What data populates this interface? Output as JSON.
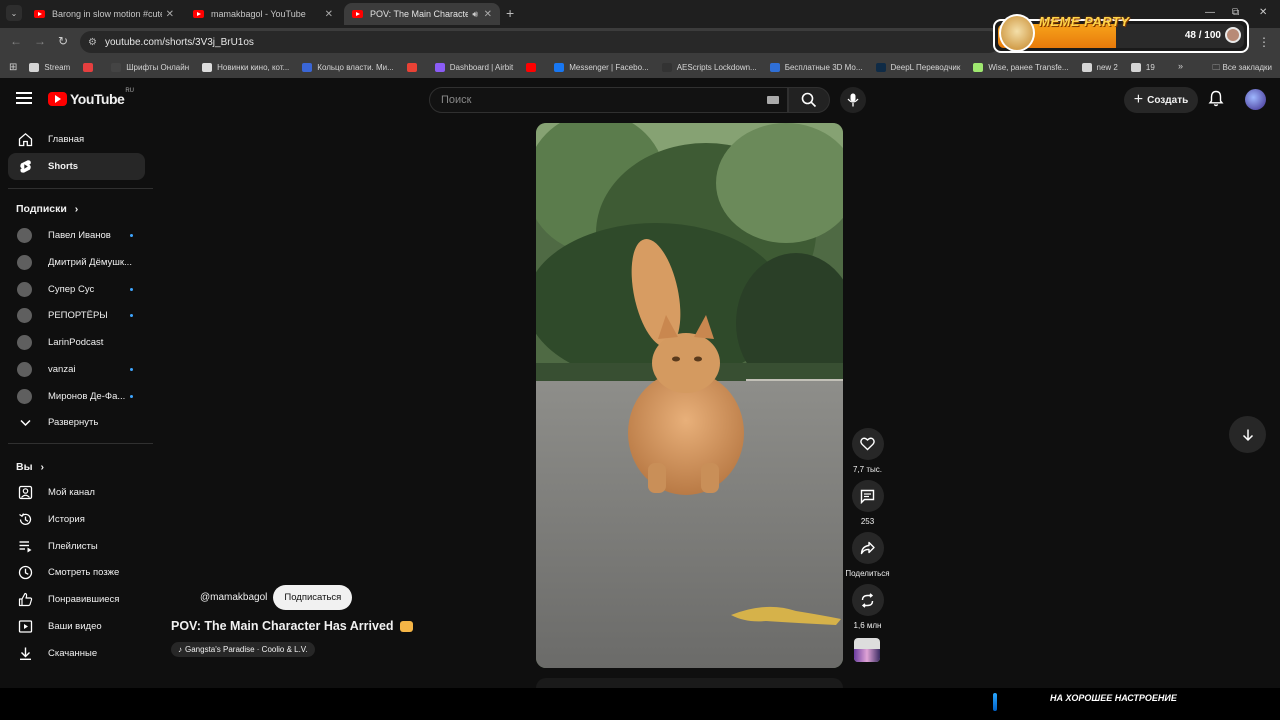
{
  "browser": {
    "tabs": [
      {
        "label": "Barong in slow motion #cutecat",
        "active": false
      },
      {
        "label": "mamakbagol - YouTube",
        "active": false
      },
      {
        "label": "POV: The Main Character H",
        "active": true
      }
    ],
    "url": "youtube.com/shorts/3V3j_BrU1os",
    "bookmarks": [
      {
        "label": "Stream",
        "icon": "folder-icon",
        "color": "#d5d5d5"
      },
      {
        "label": "",
        "icon": "bookmark-icon",
        "color": "#e53f3f"
      },
      {
        "label": "Шрифты Онлайн",
        "icon": "font-icon",
        "color": "#444"
      },
      {
        "label": "Новинки кино, кот...",
        "icon": "apple-icon",
        "color": "#ddd"
      },
      {
        "label": "Кольцо власти. Ми...",
        "icon": "r-icon",
        "color": "#3a66d6"
      },
      {
        "label": "",
        "icon": "gmail-icon",
        "color": "#e94235"
      },
      {
        "label": "Dashboard | Airbit",
        "icon": "airbit-icon",
        "color": "#8b5cf6"
      },
      {
        "label": "",
        "icon": "youtube-icon",
        "color": "#ff0000"
      },
      {
        "label": "Messenger | Facebo...",
        "icon": "facebook-icon",
        "color": "#1877f2"
      },
      {
        "label": "AEScripts Lockdown...",
        "icon": "aescripts-icon",
        "color": "#333"
      },
      {
        "label": "Бесплатные 3D Мо...",
        "icon": "3d-icon",
        "color": "#2f6fd6"
      },
      {
        "label": "DeepL Переводчик",
        "icon": "deepl-icon",
        "color": "#0f2b46"
      },
      {
        "label": "Wise, ранее Transfe...",
        "icon": "wise-icon",
        "color": "#9fe870"
      },
      {
        "label": "new 2",
        "icon": "folder-icon",
        "color": "#d5d5d5"
      },
      {
        "label": "19",
        "icon": "folder-icon",
        "color": "#d5d5d5"
      }
    ],
    "bookmarks_more": "»",
    "all_bookmarks": "Все закладки"
  },
  "meme_party": {
    "title": "MEME PARTY",
    "count": "48 / 100",
    "progress": 0.48
  },
  "header": {
    "logo_text": "YouTube",
    "region": "RU",
    "search_placeholder": "Поиск",
    "create_label": "Создать"
  },
  "sidebar": {
    "main": [
      {
        "label": "Главная",
        "icon": "home-icon"
      },
      {
        "label": "Shorts",
        "icon": "shorts-icon",
        "active": true
      }
    ],
    "subscriptions_title": "Подписки",
    "subscriptions": [
      {
        "label": "Павел Иванов",
        "new": true
      },
      {
        "label": "Дмитрий Дёмушк...",
        "new": false
      },
      {
        "label": "Супер Сус",
        "new": true
      },
      {
        "label": "РЕПОРТЁРЫ",
        "new": true
      },
      {
        "label": "LarinPodcast",
        "new": false
      },
      {
        "label": "vanzai",
        "new": true
      },
      {
        "label": "Миронов Де-Фа...",
        "new": true
      }
    ],
    "expand_label": "Развернуть",
    "you_title": "Вы",
    "you_items": [
      {
        "label": "Мой канал",
        "icon": "channel-icon"
      },
      {
        "label": "История",
        "icon": "history-icon"
      },
      {
        "label": "Плейлисты",
        "icon": "playlist-icon"
      },
      {
        "label": "Смотреть позже",
        "icon": "clock-icon"
      },
      {
        "label": "Понравившиеся",
        "icon": "thumb-up-icon"
      },
      {
        "label": "Ваши видео",
        "icon": "video-icon"
      },
      {
        "label": "Скачанные",
        "icon": "download-icon"
      }
    ]
  },
  "short": {
    "channel": "@mamakbagol",
    "subscribe_label": "Подписаться",
    "title": "POV: The Main Character Has Arrived",
    "music": "Gangsta's Paradise · Coolio & L.V.",
    "likes": "7,7 тыс.",
    "comments": "253",
    "share_label": "Поделиться",
    "remix_count": "1,6 млн"
  },
  "overlay": {
    "mood_text": "НА ХОРОШЕЕ НАСТРОЕНИЕ"
  }
}
